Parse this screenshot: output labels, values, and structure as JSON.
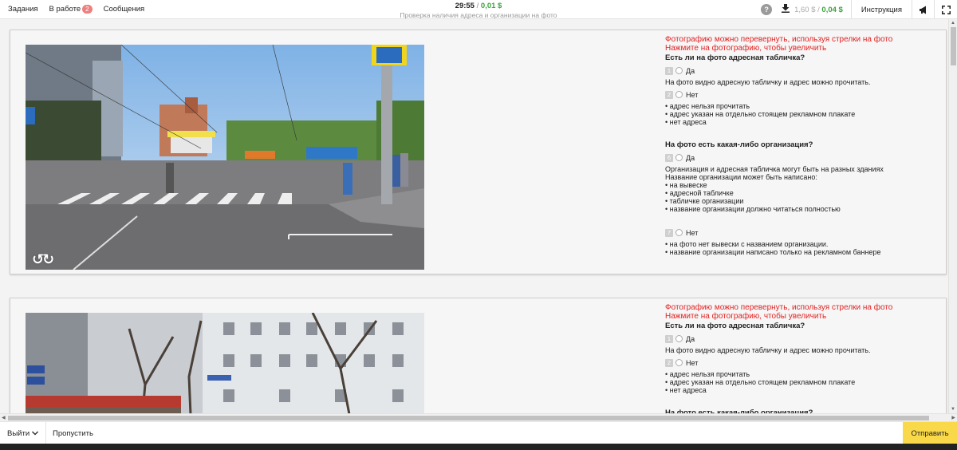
{
  "nav": {
    "tasks": "Задания",
    "in_progress": "В работе",
    "in_progress_count": "2",
    "messages": "Сообщения"
  },
  "header": {
    "timer": "29:55",
    "separator": "/",
    "price": "0,01 $",
    "subtitle": "Проверка наличия адреса и организации на фото"
  },
  "tools": {
    "help": "?",
    "balance_grey": "1,60 $",
    "balance_sep": "/",
    "balance_green": "0,04 $",
    "instruction": "Инструкция"
  },
  "task": {
    "rotate_hint": "Фотографию можно перевернуть, используя стрелки на фото",
    "zoom_hint": "Нажмите на фотографию, чтобы увеличить",
    "q1": "Есть ли на фото адресная табличка?",
    "q1_yes_key": "1",
    "q1_yes": "Да",
    "q1_yes_desc": "На фото видно адресную табличку и адрес можно прочитать.",
    "q1_no_key": "2",
    "q1_no": "Нет",
    "q1_no_b1": "• адрес нельзя прочитать",
    "q1_no_b2": "• адрес указан на отдельно стоящем рекламном плакате",
    "q1_no_b3": "• нет адреса",
    "q2": "На фото есть какая-либо организация?",
    "q2_yes_key": "6",
    "q2_yes": "Да",
    "q2_yes_d1": "Организация и адресная табличка могут быть на разных зданиях",
    "q2_yes_d2": "Название организации может быть написано:",
    "q2_yes_b1": "• на вывеске",
    "q2_yes_b2": "• адресной табличке",
    "q2_yes_b3": "• табличке организации",
    "q2_yes_b4": "• название организации должно читаться полностью",
    "q2_no_key": "7",
    "q2_no": "Нет",
    "q2_no_b1": "• на фото нет вывески с названием организации.",
    "q2_no_b2": "• название организации написано только на рекламном баннере"
  },
  "footer": {
    "exit": "Выйти",
    "skip": "Пропустить",
    "send": "Отправить"
  },
  "colors": {
    "accent_yellow": "#f9d94a",
    "price_green": "#3aa33a",
    "hint_red": "#e32222"
  }
}
